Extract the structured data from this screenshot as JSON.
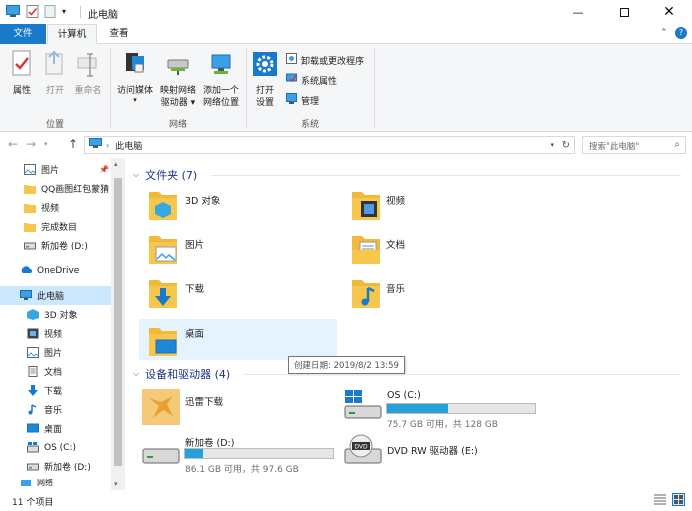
{
  "window": {
    "title": "此电脑"
  },
  "ribbon_tabs": {
    "file": "文件",
    "computer": "计算机",
    "view": "查看"
  },
  "ribbon": {
    "location": {
      "properties": "属性",
      "open": "打开",
      "rename": "重命名",
      "group_label": "位置"
    },
    "network": {
      "access_media": "访问媒体",
      "map_drive_l1": "映射网络",
      "map_drive_l2": "驱动器",
      "add_location_l1": "添加一个",
      "add_location_l2": "网络位置",
      "group_label": "网络"
    },
    "system": {
      "open_settings_l1": "打开",
      "open_settings_l2": "设置",
      "uninstall": "卸载或更改程序",
      "system_properties": "系统属性",
      "manage": "管理",
      "group_label": "系统"
    }
  },
  "address": {
    "path": "此电脑",
    "search_placeholder": "搜索\"此电脑\""
  },
  "nav_pane": {
    "quick_access": [
      "图片",
      "QQ画图红包蒙猜",
      "视频",
      "完成数目",
      "新加卷 (D:)"
    ],
    "onedrive": "OneDrive",
    "this_pc": "此电脑",
    "this_pc_children": [
      "3D 对象",
      "视频",
      "图片",
      "文档",
      "下载",
      "音乐",
      "桌面",
      "OS (C:)",
      "新加卷 (D:)"
    ],
    "network": "网络"
  },
  "folders_section": {
    "header": "文件夹 (7)",
    "items": [
      {
        "name": "3D 对象",
        "icon": "3d-objects-folder-icon"
      },
      {
        "name": "视频",
        "icon": "videos-folder-icon"
      },
      {
        "name": "图片",
        "icon": "pictures-folder-icon"
      },
      {
        "name": "文档",
        "icon": "documents-folder-icon"
      },
      {
        "name": "下载",
        "icon": "downloads-folder-icon"
      },
      {
        "name": "音乐",
        "icon": "music-folder-icon"
      },
      {
        "name": "桌面",
        "icon": "desktop-folder-icon"
      }
    ],
    "tooltip": "创建日期: 2019/8/2 13:59"
  },
  "drives_section": {
    "header": "设备和驱动器 (4)",
    "items": [
      {
        "name": "迅雷下载",
        "icon": "xunlei-icon"
      },
      {
        "name": "OS (C:)",
        "free": "75.7 GB 可用，共 128 GB",
        "used_fraction": 0.41
      },
      {
        "name": "新加卷 (D:)",
        "free": "86.1 GB 可用，共 97.6 GB",
        "used_fraction": 0.12
      },
      {
        "name": "DVD RW 驱动器 (E:)",
        "icon": "dvd-drive-icon"
      }
    ]
  },
  "status": {
    "item_count": "11 个项目"
  },
  "colors": {
    "accent": "#1979ca",
    "selection": "#cce8ff",
    "drive_fill": "#26a0da",
    "folder": "#f7c64c"
  }
}
